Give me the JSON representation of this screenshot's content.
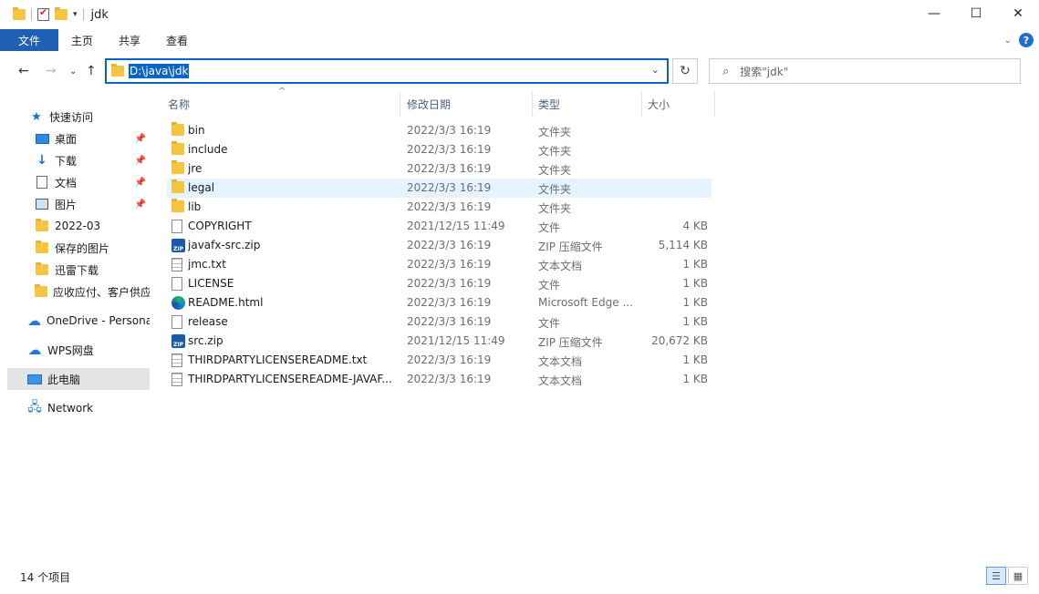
{
  "window": {
    "title": "jdk"
  },
  "window_controls": {
    "minimize": "—",
    "maximize": "☐",
    "close": "✕"
  },
  "ribbon": {
    "tabs": [
      "文件",
      "主页",
      "共享",
      "查看"
    ],
    "help": "?"
  },
  "address": {
    "path": "D:\\java\\jdk"
  },
  "search": {
    "placeholder": "搜索\"jdk\""
  },
  "nav_pane": {
    "items": [
      {
        "label": "快速访问",
        "icon": "star-icon"
      },
      {
        "label": "桌面",
        "icon": "desktop-icon",
        "pinned": true
      },
      {
        "label": "下载",
        "icon": "download-icon",
        "pinned": true
      },
      {
        "label": "文档",
        "icon": "document-icon",
        "pinned": true
      },
      {
        "label": "图片",
        "icon": "picture-icon",
        "pinned": true
      },
      {
        "label": "2022-03",
        "icon": "folder-icon"
      },
      {
        "label": "保存的图片",
        "icon": "folder-icon"
      },
      {
        "label": "迅雷下载",
        "icon": "folder-icon"
      },
      {
        "label": "应收应付、客户供应",
        "icon": "folder-icon"
      },
      {
        "label": "OneDrive - Persona",
        "icon": "cloud-icon"
      },
      {
        "label": "WPS网盘",
        "icon": "cloud-icon"
      },
      {
        "label": "此电脑",
        "icon": "pc-icon",
        "selected": true
      },
      {
        "label": "Network",
        "icon": "network-icon"
      }
    ]
  },
  "columns": {
    "name": "名称",
    "date": "修改日期",
    "type": "类型",
    "size": "大小"
  },
  "files": [
    {
      "name": "bin",
      "date": "2022/3/3 16:19",
      "type": "文件夹",
      "size": "",
      "kind": "folder"
    },
    {
      "name": "include",
      "date": "2022/3/3 16:19",
      "type": "文件夹",
      "size": "",
      "kind": "folder"
    },
    {
      "name": "jre",
      "date": "2022/3/3 16:19",
      "type": "文件夹",
      "size": "",
      "kind": "folder"
    },
    {
      "name": "legal",
      "date": "2022/3/3 16:19",
      "type": "文件夹",
      "size": "",
      "kind": "folder",
      "hover": true
    },
    {
      "name": "lib",
      "date": "2022/3/3 16:19",
      "type": "文件夹",
      "size": "",
      "kind": "folder"
    },
    {
      "name": "COPYRIGHT",
      "date": "2021/12/15 11:49",
      "type": "文件",
      "size": "4 KB",
      "kind": "file"
    },
    {
      "name": "javafx-src.zip",
      "date": "2022/3/3 16:19",
      "type": "ZIP 压缩文件",
      "size": "5,114 KB",
      "kind": "zip"
    },
    {
      "name": "jmc.txt",
      "date": "2022/3/3 16:19",
      "type": "文本文档",
      "size": "1 KB",
      "kind": "text"
    },
    {
      "name": "LICENSE",
      "date": "2022/3/3 16:19",
      "type": "文件",
      "size": "1 KB",
      "kind": "file"
    },
    {
      "name": "README.html",
      "date": "2022/3/3 16:19",
      "type": "Microsoft Edge ...",
      "size": "1 KB",
      "kind": "edge"
    },
    {
      "name": "release",
      "date": "2022/3/3 16:19",
      "type": "文件",
      "size": "1 KB",
      "kind": "file"
    },
    {
      "name": "src.zip",
      "date": "2021/12/15 11:49",
      "type": "ZIP 压缩文件",
      "size": "20,672 KB",
      "kind": "zip"
    },
    {
      "name": "THIRDPARTYLICENSEREADME.txt",
      "date": "2022/3/3 16:19",
      "type": "文本文档",
      "size": "1 KB",
      "kind": "text"
    },
    {
      "name": "THIRDPARTYLICENSEREADME-JAVAF...",
      "date": "2022/3/3 16:19",
      "type": "文本文档",
      "size": "1 KB",
      "kind": "text"
    }
  ],
  "status": {
    "count": "14 个项目"
  },
  "colors": {
    "accent": "#1f5fb4",
    "selection": "#e5f3ff",
    "header_text": "#4a6281"
  }
}
